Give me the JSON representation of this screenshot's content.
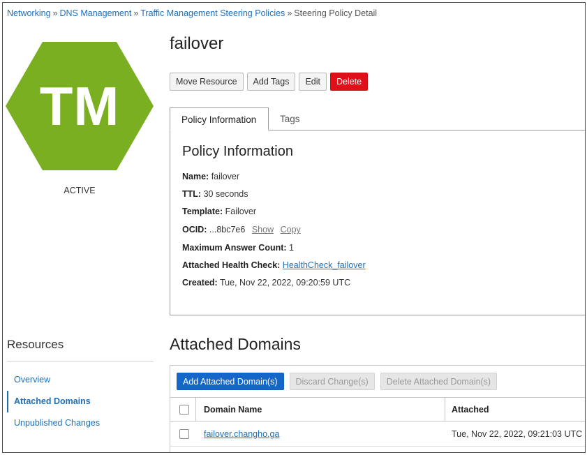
{
  "breadcrumb": {
    "items": [
      "Networking",
      "DNS Management",
      "Traffic Management Steering Policies"
    ],
    "separator": "»",
    "current": "Steering Policy Detail"
  },
  "resource_icon": {
    "initials": "TM",
    "color": "#7aaf22",
    "icon_name": "hexagon-icon"
  },
  "status": "ACTIVE",
  "title": "failover",
  "actions": {
    "move": "Move Resource",
    "tags": "Add Tags",
    "edit": "Edit",
    "delete": "Delete"
  },
  "tabs": [
    {
      "label": "Policy Information",
      "active": true
    },
    {
      "label": "Tags",
      "active": false
    }
  ],
  "policy_info": {
    "heading": "Policy Information",
    "name_label": "Name:",
    "name_value": "failover",
    "ttl_label": "TTL:",
    "ttl_value": "30 seconds",
    "template_label": "Template:",
    "template_value": "Failover",
    "ocid_label": "OCID:",
    "ocid_value": "...8bc7e6",
    "ocid_show": "Show",
    "ocid_copy": "Copy",
    "max_answer_label": "Maximum Answer Count:",
    "max_answer_value": "1",
    "health_check_label": "Attached Health Check:",
    "health_check_value": "HealthCheck_failover",
    "created_label": "Created:",
    "created_value": "Tue, Nov 22, 2022, 09:20:59 UTC"
  },
  "resources": {
    "title": "Resources",
    "items": [
      {
        "label": "Overview",
        "active": false
      },
      {
        "label": "Attached Domains",
        "active": true
      },
      {
        "label": "Unpublished Changes",
        "active": false
      }
    ]
  },
  "attached_domains": {
    "title": "Attached Domains",
    "add_button": "Add Attached Domain(s)",
    "discard_button": "Discard Change(s)",
    "delete_button": "Delete Attached Domain(s)",
    "columns": [
      "Domain Name",
      "Attached"
    ],
    "rows": [
      {
        "domain": "failover.changho.ga",
        "attached": "Tue, Nov 22, 2022, 09:21:03 UTC"
      }
    ]
  },
  "colors": {
    "link": "#1f6fb8",
    "danger": "#e0101a",
    "primary": "#1467c8",
    "icon_green": "#7aaf22"
  }
}
